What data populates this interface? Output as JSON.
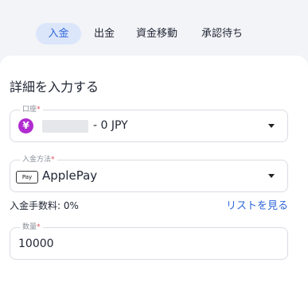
{
  "tabs": [
    {
      "label": "入金",
      "active": true
    },
    {
      "label": "出金",
      "active": false
    },
    {
      "label": "資金移動",
      "active": false
    },
    {
      "label": "承認待ち",
      "active": false
    }
  ],
  "section_title": "詳細を入力する",
  "account": {
    "label": "口座",
    "required_mark": "*",
    "currency_symbol": "¥",
    "value": "- 0 JPY",
    "icon": "yen-icon",
    "dropdown_icon": "chevron-down-icon"
  },
  "deposit_method": {
    "label": "入金方法",
    "required_mark": "*",
    "badge": "Pay",
    "value": "ApplePay",
    "icon": "applepay-icon",
    "dropdown_icon": "chevron-down-icon"
  },
  "fee_text": "入金手数料: 0%",
  "list_link": "リストを見る",
  "quantity": {
    "label": "数量",
    "required_mark": "*",
    "value": "10000"
  },
  "colors": {
    "accent": "#2f66d8",
    "active_tab_bg": "#dbe6fb",
    "yen_badge": "#b02bd0",
    "required": "#e24b5a"
  }
}
